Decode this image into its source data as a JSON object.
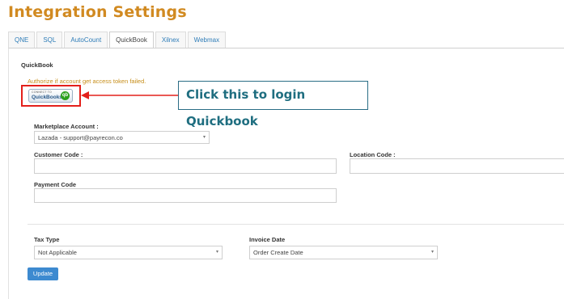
{
  "page": {
    "title": "Integration Settings"
  },
  "tabs": [
    {
      "label": "QNE"
    },
    {
      "label": "SQL"
    },
    {
      "label": "AutoCount"
    },
    {
      "label": "QuickBook",
      "active": true
    },
    {
      "label": "Xilnex"
    },
    {
      "label": "Webmax"
    }
  ],
  "section": {
    "title": "QuickBook",
    "warning": "Authorize if account get access token failed."
  },
  "connect_button": {
    "small_text": "CONNECT TO",
    "big_text": "QuickBooks",
    "logo": "qb"
  },
  "callout": {
    "text": "Click this to login Quickbook"
  },
  "form": {
    "marketplace_label": "Marketplace Account :",
    "marketplace_value": "Lazada - support@payrecon.co",
    "customer_code_label": "Customer Code :",
    "customer_code_value": "",
    "location_code_label": "Location Code :",
    "location_code_value": "",
    "payment_code_label": "Payment Code",
    "payment_code_value": "",
    "tax_type_label": "Tax Type",
    "tax_type_value": "Not Applicable",
    "invoice_date_label": "Invoice Date",
    "invoice_date_value": "Order Create Date",
    "update_label": "Update"
  },
  "colors": {
    "title": "#d18a21",
    "warning": "#c78e19",
    "tab_link": "#2f7db8",
    "highlight": "#e3201b",
    "callout": "#1f6e80",
    "update_button": "#3d8ad0"
  }
}
